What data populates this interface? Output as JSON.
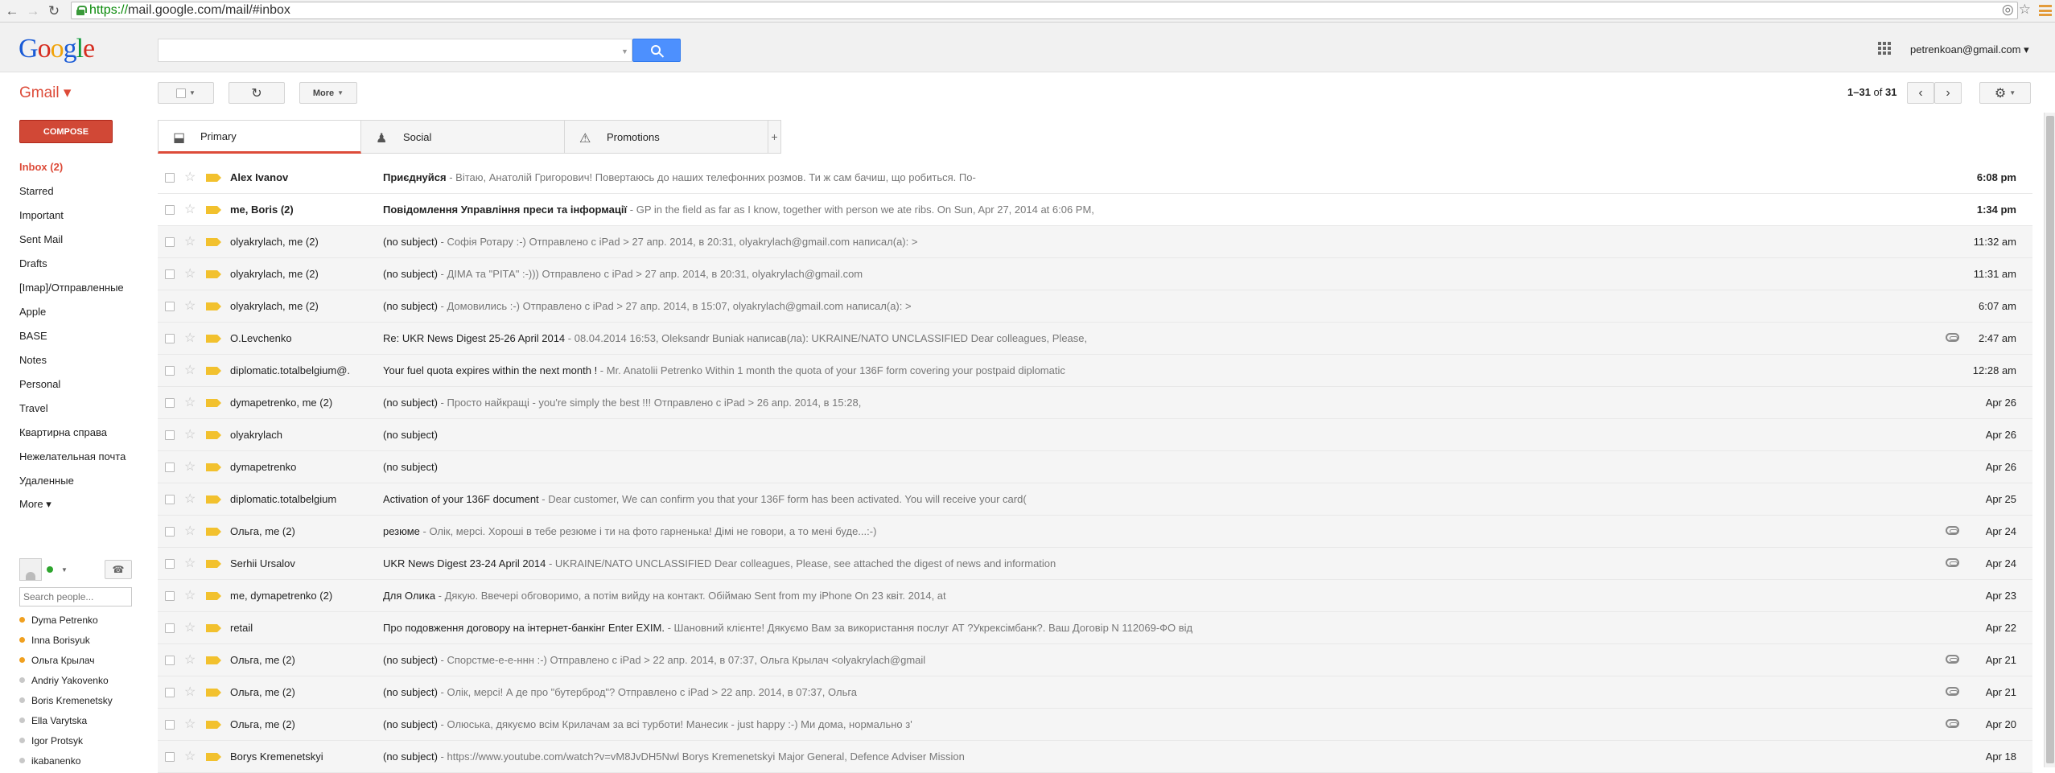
{
  "browser": {
    "url_scheme": "https://",
    "url_rest": "mail.google.com/mail/#inbox",
    "back_icon": "back-arrow-icon",
    "forward_icon": "forward-arrow-icon",
    "reload_icon": "reload-icon"
  },
  "header": {
    "logo_letters": [
      "G",
      "o",
      "o",
      "g",
      "l",
      "e"
    ],
    "logo_colors": [
      "#1a5bd6",
      "#d62d20",
      "#f0a30a",
      "#1a5bd6",
      "#109a3a",
      "#d62d20"
    ],
    "search_placeholder": "",
    "account": "petrenkoan@gmail.com ▾"
  },
  "toolbar": {
    "gmail_label": "Gmail ▾",
    "more_label": "More",
    "pager_range": "1–31",
    "pager_of": "of",
    "pager_total": "31"
  },
  "sidebar": {
    "compose": "COMPOSE",
    "items": [
      {
        "label": "Inbox (2)",
        "active": true
      },
      {
        "label": "Starred"
      },
      {
        "label": "Important"
      },
      {
        "label": "Sent Mail"
      },
      {
        "label": "Drafts"
      },
      {
        "label": "[Imap]/Отправленные"
      },
      {
        "label": "Apple"
      },
      {
        "label": "BASE"
      },
      {
        "label": "Notes"
      },
      {
        "label": "Personal"
      },
      {
        "label": "Travel"
      },
      {
        "label": "Квартирна справа"
      },
      {
        "label": "Нежелательная почта"
      },
      {
        "label": "Удаленные"
      },
      {
        "label": "More ▾"
      }
    ],
    "people_search_placeholder": "Search people...",
    "contacts": [
      {
        "name": "Dyma Petrenko",
        "status": "idle"
      },
      {
        "name": "Inna Borisyuk",
        "status": "idle"
      },
      {
        "name": "Ольга Крылач",
        "status": "idle"
      },
      {
        "name": "Andriy Yakovenko",
        "status": "offline"
      },
      {
        "name": "Boris Kremenetsky",
        "status": "offline"
      },
      {
        "name": "Ella Varytska",
        "status": "offline"
      },
      {
        "name": "Igor Protsyk",
        "status": "offline"
      },
      {
        "name": "ikabanenko",
        "status": "offline"
      }
    ]
  },
  "tabs": [
    {
      "label": "Primary",
      "icon": "inbox-tray-icon"
    },
    {
      "label": "Social",
      "icon": "people-icon"
    },
    {
      "label": "Promotions",
      "icon": "tag-icon"
    }
  ],
  "emails": [
    {
      "sender": "Alex Ivanov",
      "subject": "Приєднуйся",
      "preview": " - Вітаю, Анатолій Григорович! Повертаюсь до наших телефонних розмов. Ти ж сам бачиш, що робиться. По-",
      "date": "6:08 pm",
      "unread": true,
      "attachment": false
    },
    {
      "sender": "me, Boris (2)",
      "subject": "Повідомлення Управління преси та інформації",
      "preview": " - GP in the field as far as I know, together with person we ate ribs. On Sun, Apr 27, 2014 at 6:06 PM,",
      "date": "1:34 pm",
      "unread": true,
      "attachment": false
    },
    {
      "sender": "olyakrylach, me (2)",
      "subject": "(no subject)",
      "preview": " - Софія Ротару :-) Отправлено с iPad > 27 апр. 2014, в 20:31, olyakrylach@gmail.com написал(а): >",
      "date": "11:32 am",
      "unread": false,
      "attachment": false
    },
    {
      "sender": "olyakrylach, me (2)",
      "subject": "(no subject)",
      "preview": " - ДІМА та \"РІТА\" :-))) Отправлено с iPad > 27 апр. 2014, в 20:31, olyakrylach@gmail.com",
      "date": "11:31 am",
      "unread": false,
      "attachment": false
    },
    {
      "sender": "olyakrylach, me (2)",
      "subject": "(no subject)",
      "preview": " - Домовились :-) Отправлено с iPad > 27 апр. 2014, в 15:07, olyakrylach@gmail.com написал(а): >",
      "date": "6:07 am",
      "unread": false,
      "attachment": false
    },
    {
      "sender": "O.Levchenko",
      "subject": "Re: UKR News Digest 25-26 April 2014",
      "preview": " - 08.04.2014 16:53, Oleksandr Buniak написав(ла): UKRAINE/NATO UNCLASSIFIED Dear colleagues, Please,",
      "date": "2:47 am",
      "unread": false,
      "attachment": true
    },
    {
      "sender": "diplomatic.totalbelgium@.",
      "subject": "Your fuel quota expires within the next month !",
      "preview": " - Mr. Anatolii Petrenko Within 1 month the quota of your 136F form covering your postpaid diplomatic",
      "date": "12:28 am",
      "unread": false,
      "attachment": false
    },
    {
      "sender": "dymapetrenko, me (2)",
      "subject": "(no subject)",
      "preview": " - Просто найкращі - you're simply the best !!! Отправлено с iPad > 26 апр. 2014, в 15:28,",
      "date": "Apr 26",
      "unread": false,
      "attachment": false
    },
    {
      "sender": "olyakrylach",
      "subject": "(no subject)",
      "preview": "",
      "date": "Apr 26",
      "unread": false,
      "attachment": false
    },
    {
      "sender": "dymapetrenko",
      "subject": "(no subject)",
      "preview": "",
      "date": "Apr 26",
      "unread": false,
      "attachment": false
    },
    {
      "sender": "diplomatic.totalbelgium",
      "subject": "Activation of your 136F document",
      "preview": " - Dear customer, We can confirm you that your 136F form has been activated. You will receive your card(",
      "date": "Apr 25",
      "unread": false,
      "attachment": false
    },
    {
      "sender": "Ольга, me (2)",
      "subject": "резюме",
      "preview": " - Олік, мерсі. Хороші в тебе резюме і ти на фото гарненька! Дімі не говори, а то мені буде...:-)",
      "date": "Apr 24",
      "unread": false,
      "attachment": true
    },
    {
      "sender": "Serhii Ursalov",
      "subject": "UKR News Digest 23-24 April 2014",
      "preview": " - UKRAINE/NATO UNCLASSIFIED Dear colleagues, Please, see attached the digest of news and information",
      "date": "Apr 24",
      "unread": false,
      "attachment": true
    },
    {
      "sender": "me, dymapetrenko (2)",
      "subject": "Для Олика",
      "preview": " - Дякую. Ввечері обговоримо, а потім вийду на контакт. Обіймаю Sent from my iPhone On 23 квіт. 2014, at",
      "date": "Apr 23",
      "unread": false,
      "attachment": false
    },
    {
      "sender": "retail",
      "subject": "Про подовження договору на інтернет-банкінг Enter EXIM.",
      "preview": " - Шановний клієнте! Дякуємо Вам за використання послуг АТ ?Укрексімбанк?. Ваш Договір N 112069-ФО від",
      "date": "Apr 22",
      "unread": false,
      "attachment": false
    },
    {
      "sender": "Ольга, me (2)",
      "subject": "(no subject)",
      "preview": " - Спорстме-е-е-ннн :-) Отправлено с iPad > 22 апр. 2014, в 07:37, Ольга Крылач <olyakrylach@gmail",
      "date": "Apr 21",
      "unread": false,
      "attachment": true
    },
    {
      "sender": "Ольга, me (2)",
      "subject": "(no subject)",
      "preview": " - Олік, мерсі! А де про \"бутерброд\"? Отправлено с iPad > 22 апр. 2014, в 07:37, Ольга",
      "date": "Apr 21",
      "unread": false,
      "attachment": true
    },
    {
      "sender": "Ольга, me (2)",
      "subject": "(no subject)",
      "preview": " - Олюська, дякуємо всім Крилачам за всі турботи! Манесик - just happy :-) Ми дома, нормально з'",
      "date": "Apr 20",
      "unread": false,
      "attachment": true
    },
    {
      "sender": "Borys Kremenetskyi",
      "subject": "(no subject)",
      "preview": " - https://www.youtube.com/watch?v=vM8JvDH5Nwl Borys Kremenetskyi Major General, Defence Adviser Mission",
      "date": "Apr 18",
      "unread": false,
      "attachment": false
    }
  ]
}
